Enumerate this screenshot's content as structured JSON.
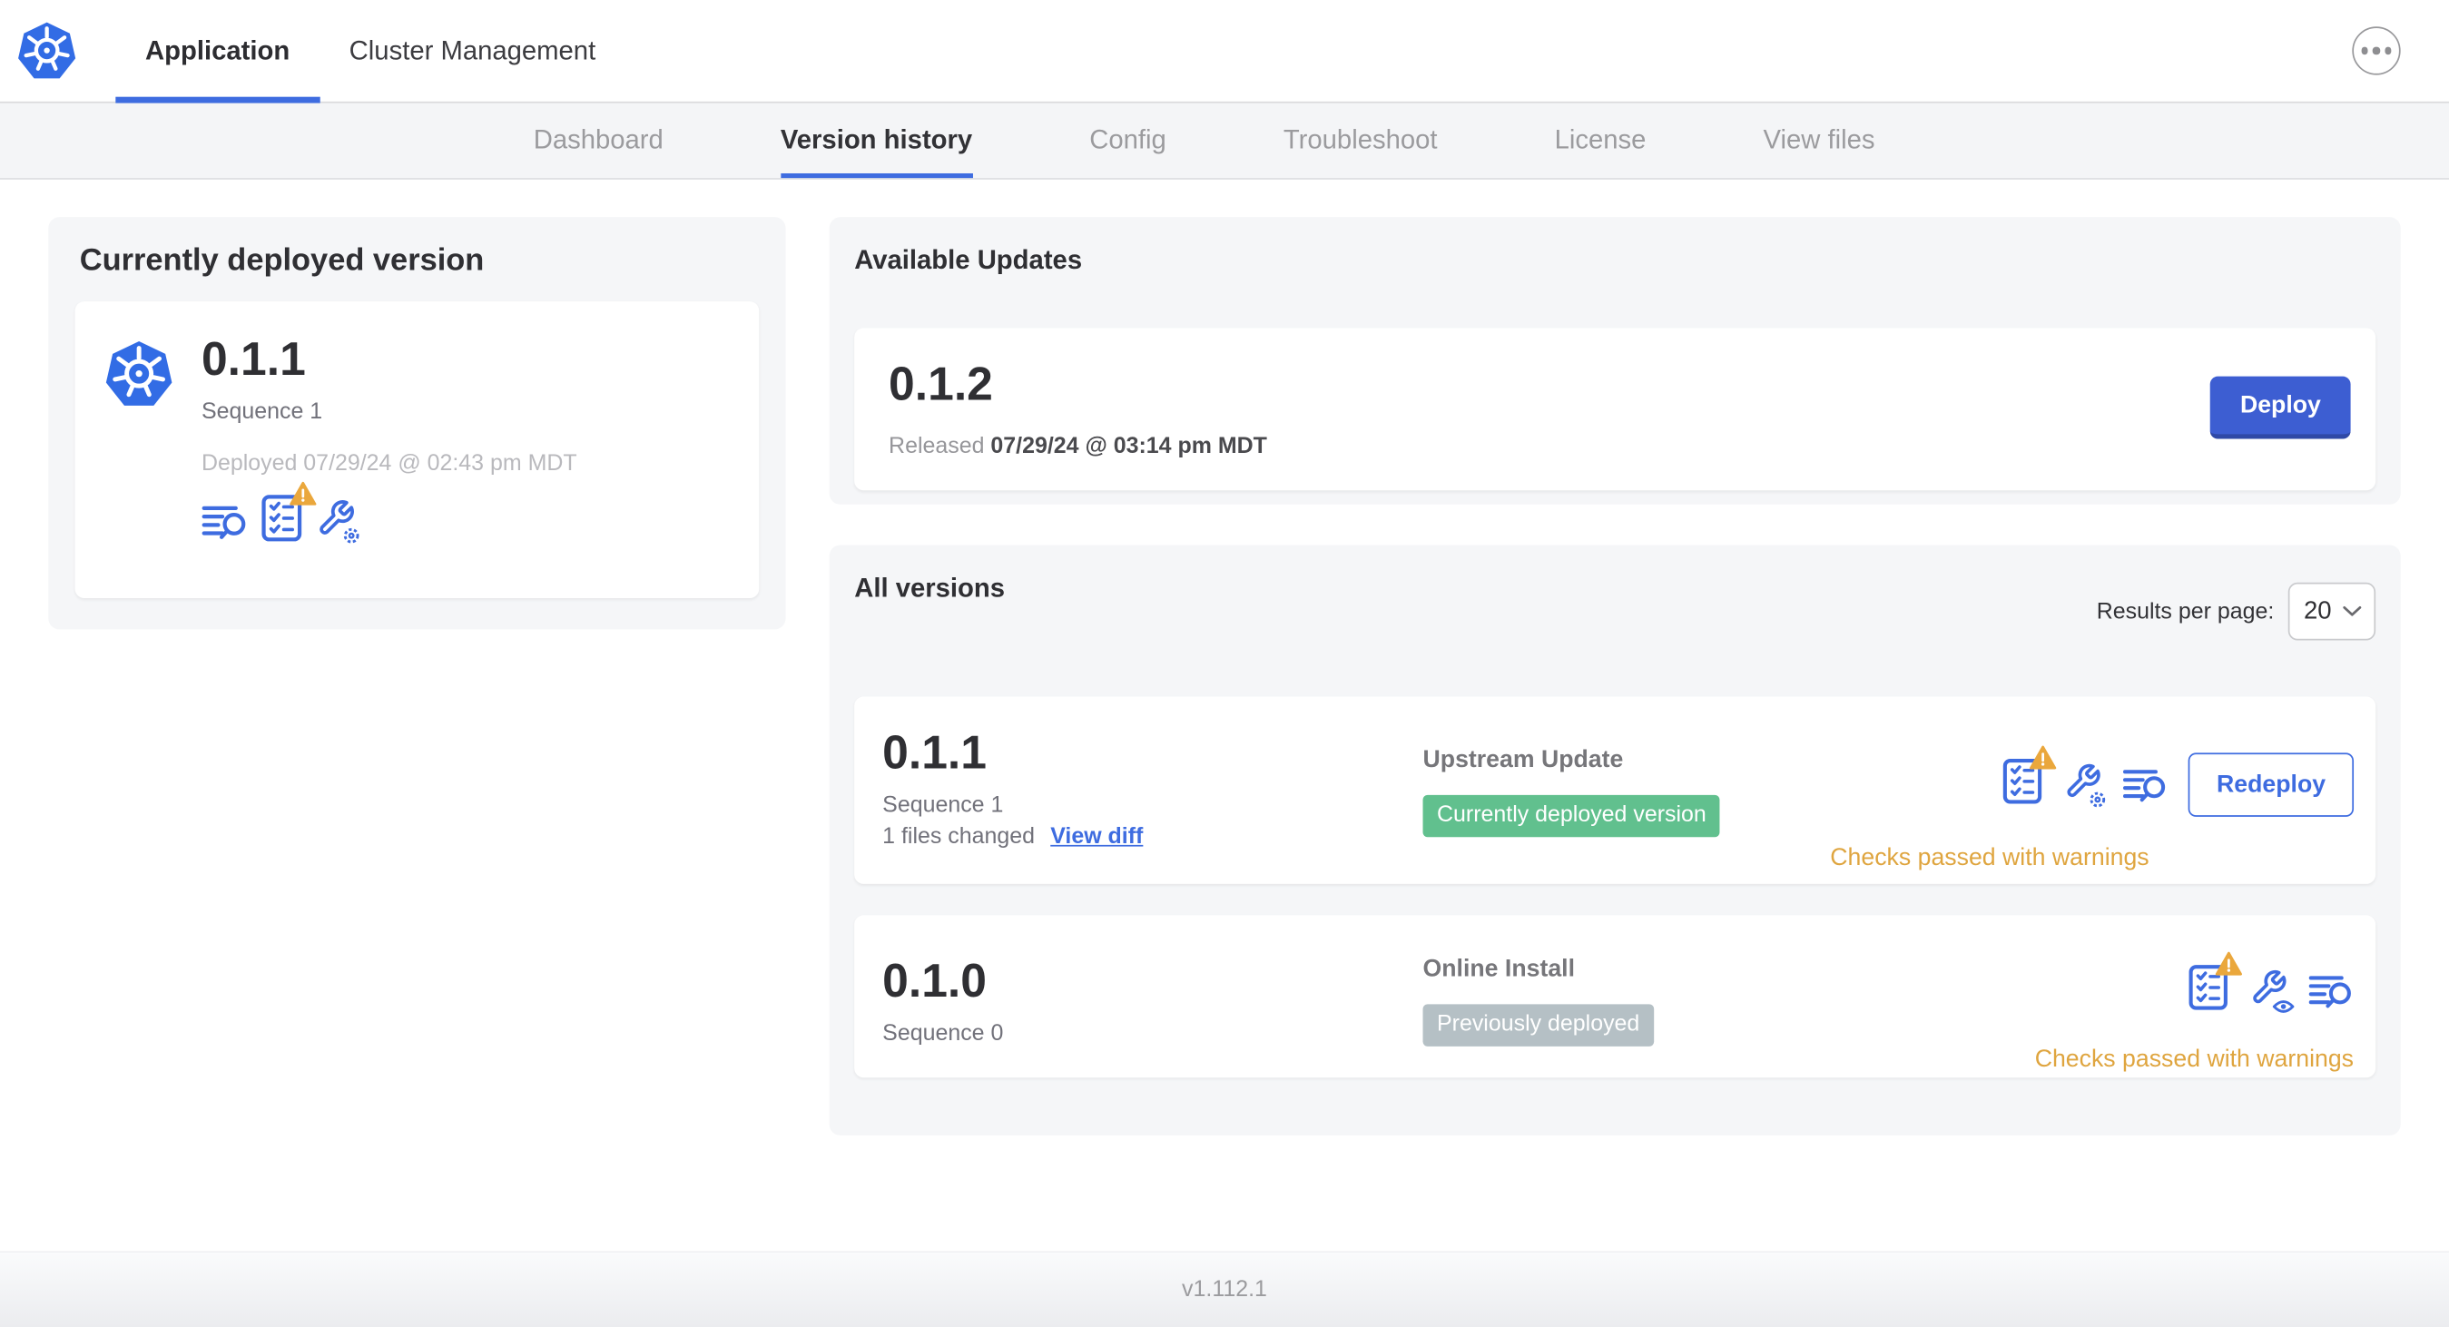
{
  "header": {
    "tabs": [
      {
        "label": "Application"
      },
      {
        "label": "Cluster Management"
      }
    ],
    "active_tab": "Application"
  },
  "subnav": {
    "tabs": [
      "Dashboard",
      "Version history",
      "Config",
      "Troubleshoot",
      "License",
      "View files"
    ],
    "active_tab": "Version history"
  },
  "current_version_card": {
    "title": "Currently deployed version",
    "version": "0.1.1",
    "sequence": "Sequence 1",
    "deployed": "Deployed 07/29/24 @ 02:43 pm MDT",
    "icons": [
      "deploy-logs-icon",
      "preflight-checks-warning-icon",
      "edit-config-icon"
    ]
  },
  "available_updates": {
    "title": "Available Updates",
    "version": "0.1.2",
    "released_label": "Released",
    "released_date": "07/29/24 @ 03:14 pm MDT",
    "deploy_button": "Deploy"
  },
  "all_versions": {
    "title": "All versions",
    "results_per_page_label": "Results per page:",
    "results_per_page_value": "20",
    "rows": [
      {
        "version": "0.1.1",
        "sequence": "Sequence 1",
        "files_changed": "1 files changed",
        "view_diff": "View diff",
        "source": "Upstream Update",
        "badge": "Currently deployed version",
        "checks": "Checks passed with warnings",
        "action": "Redeploy",
        "icons": [
          "preflight-checks-warning-icon",
          "edit-config-icon",
          "deploy-logs-icon"
        ]
      },
      {
        "version": "0.1.0",
        "sequence": "Sequence 0",
        "source": "Online Install",
        "badge": "Previously deployed",
        "checks": "Checks passed with warnings",
        "icons": [
          "preflight-checks-warning-icon",
          "view-config-icon",
          "deploy-logs-icon"
        ]
      }
    ]
  },
  "footer": {
    "app_version": "v1.112.1"
  },
  "colors": {
    "accent_blue": "#3e6ce0",
    "deploy_button_blue": "#3d5ed2",
    "green_badge": "#61c08e",
    "gray_badge": "#b5c0c5",
    "warning_orange": "#dfa53f",
    "warning_triangle": "#eaa73c",
    "kubernetes_blue": "#326ce5"
  }
}
